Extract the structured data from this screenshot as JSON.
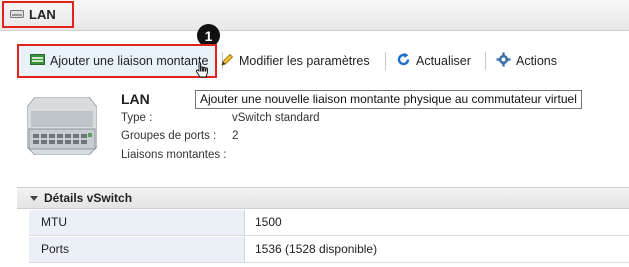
{
  "window": {
    "title": "LAN",
    "title_icon": "network-switch-icon"
  },
  "annotation": {
    "step_number": "1"
  },
  "toolbar": {
    "add_uplink_label": "Ajouter une liaison montante",
    "edit_settings_label": "Modifier les paramètres",
    "refresh_label": "Actualiser",
    "actions_label": "Actions"
  },
  "tooltip": {
    "text": "Ajouter une nouvelle liaison montante physique au commutateur virtuel"
  },
  "switch_info": {
    "name": "LAN",
    "type_label": "Type :",
    "type_value": "vSwitch standard",
    "port_groups_label": "Groupes de ports :",
    "port_groups_value": "2",
    "uplinks_label": "Liaisons montantes :",
    "uplinks_value": ""
  },
  "details": {
    "section_title": "Détails vSwitch",
    "rows": [
      {
        "key": "MTU",
        "value": "1500"
      },
      {
        "key": "Ports",
        "value": "1536 (1528 disponible)"
      }
    ]
  },
  "colors": {
    "highlight_red": "#e2231a",
    "refresh_blue": "#1f6fd1",
    "row_key_bg": "#eaf0f6"
  }
}
